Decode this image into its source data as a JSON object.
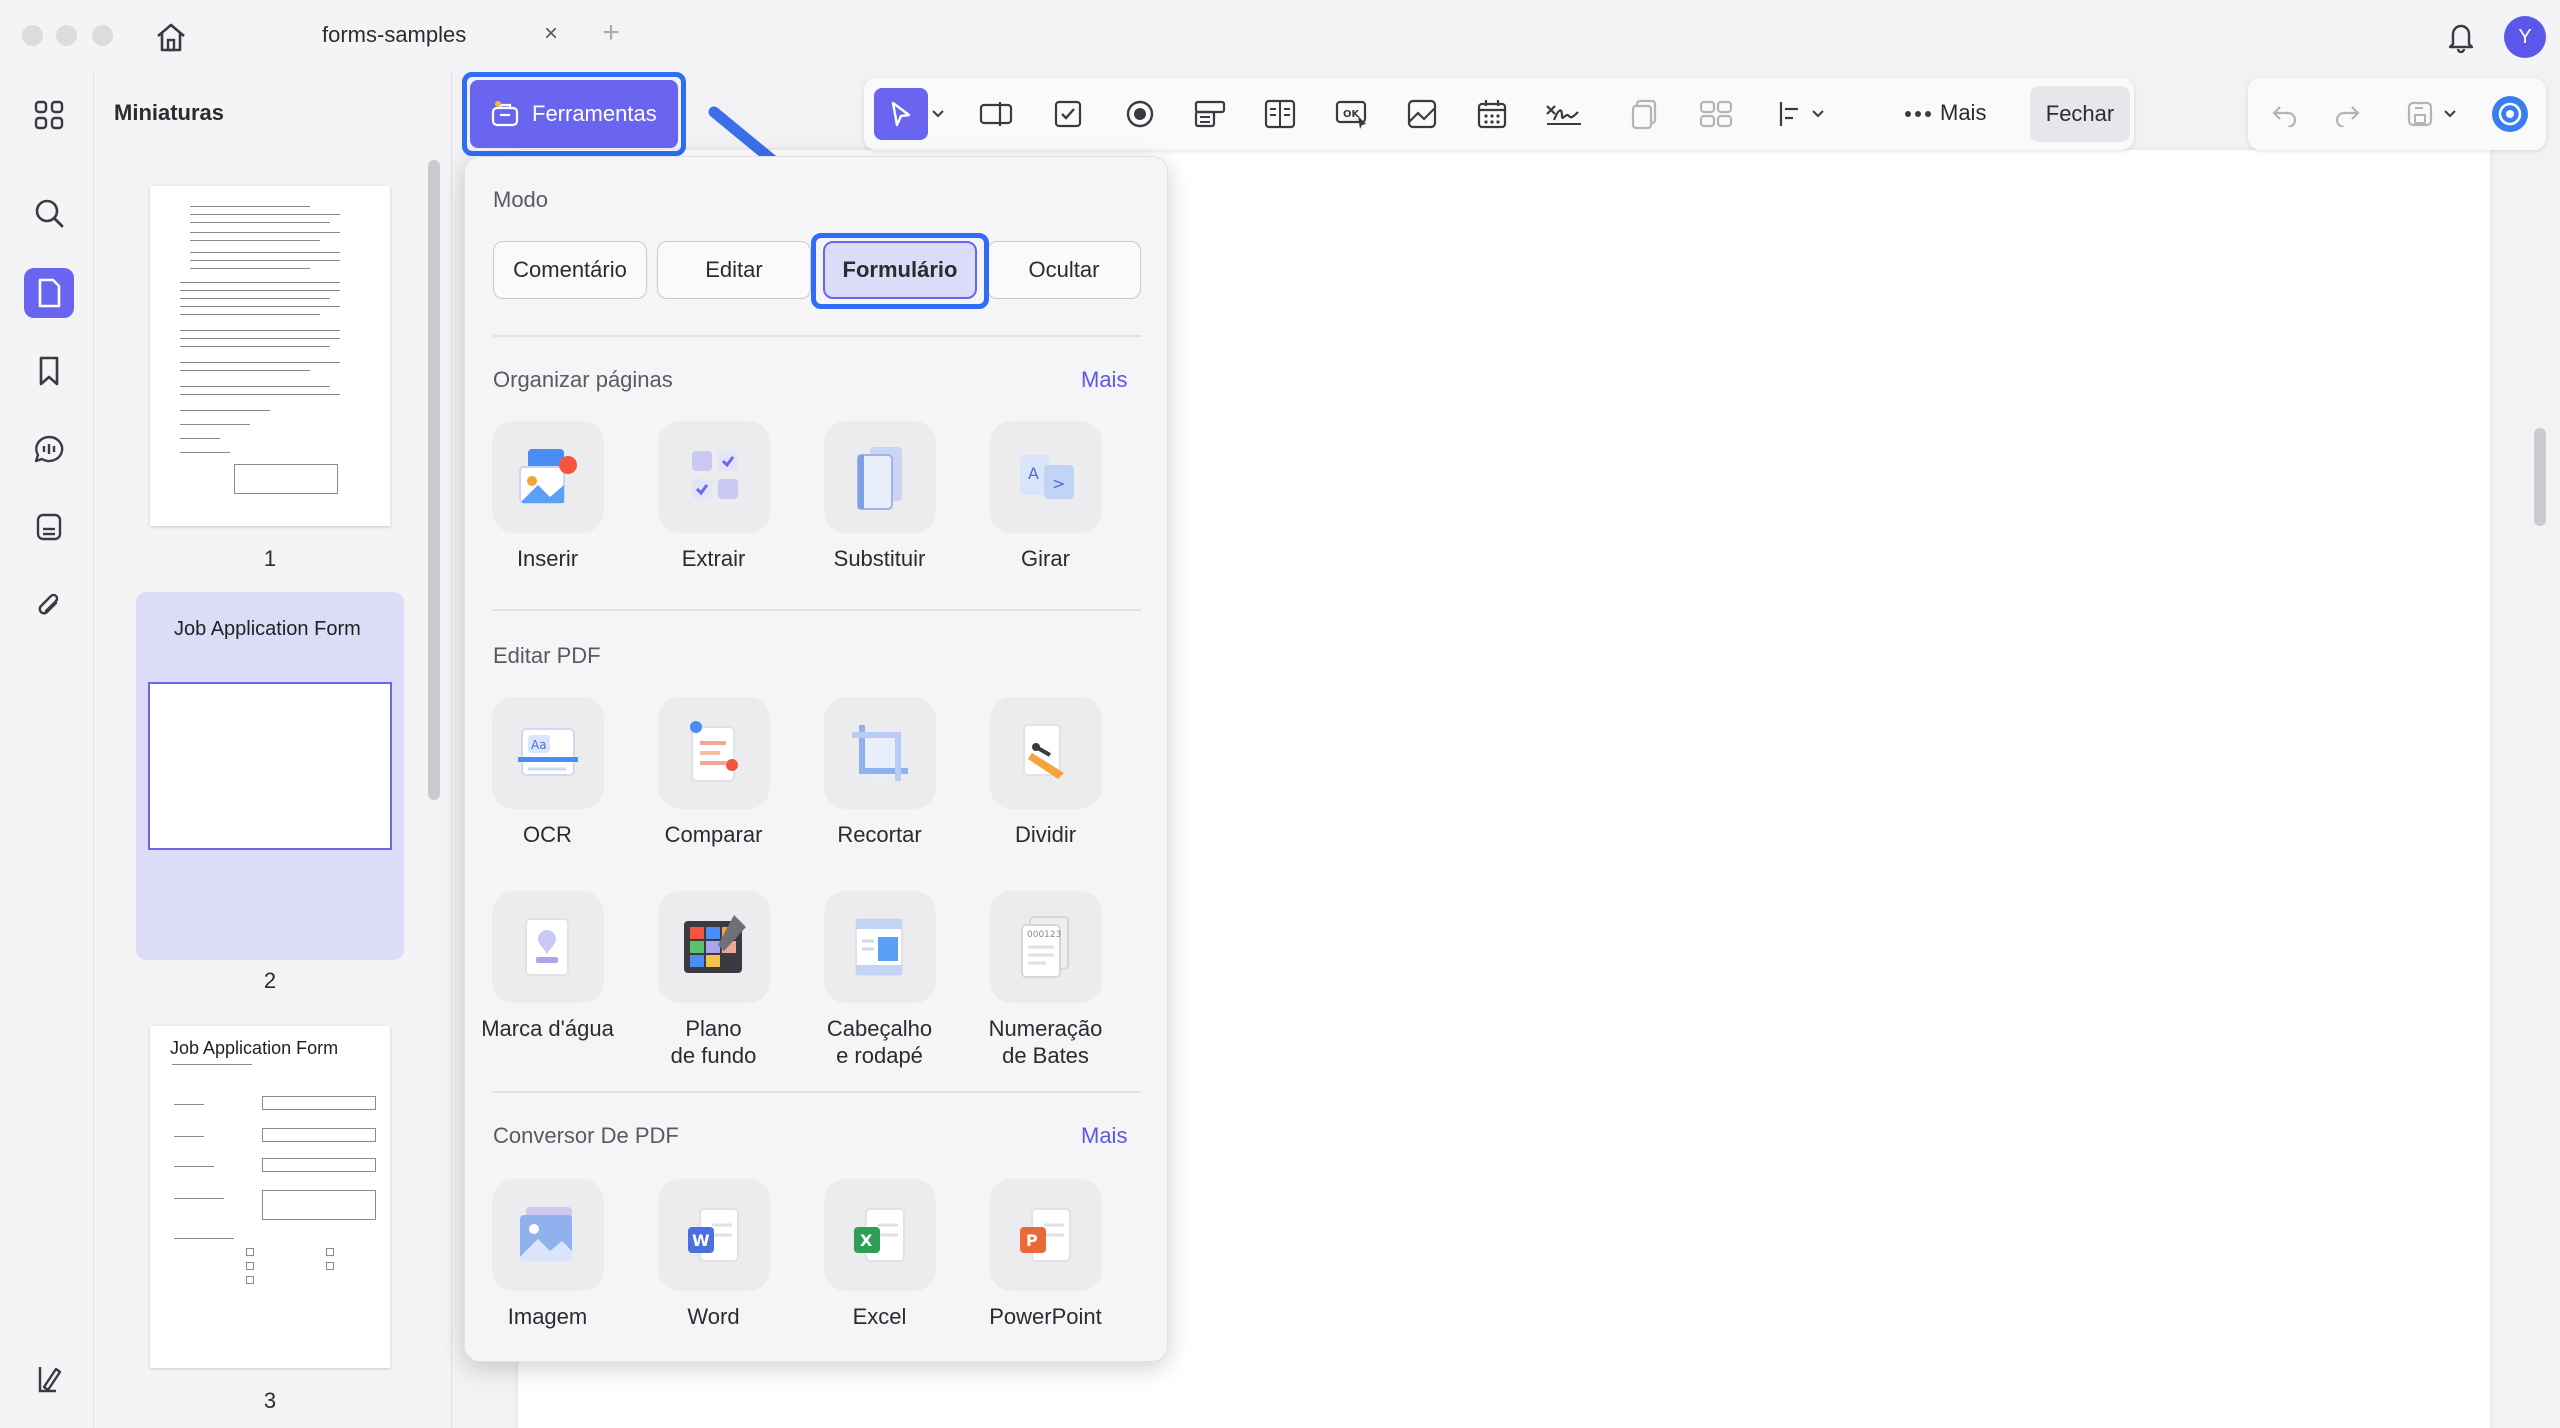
{
  "window": {
    "tab_title": "forms-samples",
    "tab_close": "×",
    "tab_add": "+",
    "avatar_initial": "Y"
  },
  "sidebar": {
    "title": "Miniaturas",
    "pages": [
      {
        "number": "1"
      },
      {
        "number": "2",
        "heading": "Job Application Form"
      },
      {
        "number": "3",
        "heading": "Job Application Form"
      }
    ]
  },
  "toolbar": {
    "tools_label": "Ferramentas",
    "more_label": "Mais",
    "close_label": "Fechar"
  },
  "panel": {
    "mode": {
      "label": "Modo",
      "options": [
        "Comentário",
        "Editar",
        "Formulário",
        "Ocultar"
      ],
      "selected": "Formulário"
    },
    "organize": {
      "label": "Organizar páginas",
      "more": "Mais",
      "items": [
        "Inserir",
        "Extrair",
        "Substituir",
        "Girar"
      ]
    },
    "edit": {
      "label": "Editar PDF",
      "items": [
        "OCR",
        "Comparar",
        "Recortar",
        "Dividir",
        "Marca d'água",
        "Plano\nde fundo",
        "Cabeçalho\ne rodapé",
        "Numeração\nde Bates"
      ]
    },
    "convert": {
      "label": "Conversor De PDF",
      "more": "Mais",
      "items": [
        "Imagem",
        "Word",
        "Excel",
        "PowerPoint"
      ]
    }
  },
  "colors": {
    "accent": "#6965f0",
    "highlight": "#2f6df6",
    "arrow": "#3b6fe8"
  }
}
